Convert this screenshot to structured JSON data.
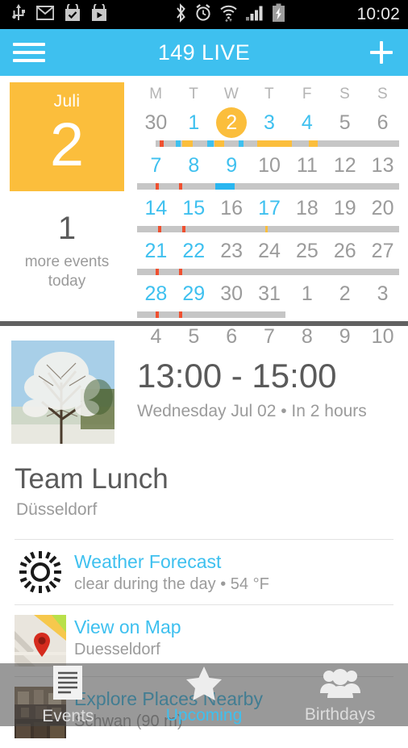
{
  "statusbar": {
    "time": "10:02",
    "left_icons": [
      "usb-icon",
      "gmail-icon",
      "checkmark-bag-icon",
      "play-store-icon"
    ],
    "right_icons": [
      "bluetooth-icon",
      "alarm-icon",
      "wifi-icon",
      "signal-icon",
      "battery-charging-icon"
    ]
  },
  "appbar": {
    "menu_icon": "hamburger-menu-icon",
    "title": "149 LIVE",
    "add_icon": "plus-icon",
    "background": "#3ec0ef"
  },
  "calendar": {
    "daycard": {
      "month": "Juli",
      "day": "2",
      "background": "#fbbe3c"
    },
    "more_count": "1",
    "more_label": "more events today",
    "weekday_headers": [
      "M",
      "T",
      "W",
      "T",
      "F",
      "S",
      "S"
    ],
    "accent_blue": "#3ec0ef",
    "accent_orange": "#fbbe3c",
    "weeks": [
      {
        "days": [
          {
            "n": "30",
            "state": "muted"
          },
          {
            "n": "1",
            "state": "active"
          },
          {
            "n": "2",
            "state": "today"
          },
          {
            "n": "3",
            "state": "active"
          },
          {
            "n": "4",
            "state": "active"
          },
          {
            "n": "5",
            "state": "muted"
          },
          {
            "n": "6",
            "state": "muted"
          }
        ],
        "bar": {
          "start_pct": 7,
          "end_pct": 99,
          "segments": [
            {
              "left_pct": 8.5,
              "width_pct": 1.6,
              "color": "#ef5030"
            },
            {
              "left_pct": 14.5,
              "width_pct": 2.0,
              "color": "#3ec0ef"
            },
            {
              "left_pct": 17.0,
              "width_pct": 4.0,
              "color": "#fbbe3c"
            },
            {
              "left_pct": 26.5,
              "width_pct": 2.4,
              "color": "#3ec0ef"
            },
            {
              "left_pct": 29.2,
              "width_pct": 3.6,
              "color": "#fbbe3c"
            },
            {
              "left_pct": 38.5,
              "width_pct": 1.8,
              "color": "#3ec0ef"
            },
            {
              "left_pct": 45.5,
              "width_pct": 13.0,
              "color": "#fbbe3c"
            },
            {
              "left_pct": 65.0,
              "width_pct": 3.2,
              "color": "#fbbe3c"
            }
          ]
        }
      },
      {
        "days": [
          {
            "n": "7",
            "state": "active"
          },
          {
            "n": "8",
            "state": "active"
          },
          {
            "n": "9",
            "state": "active"
          },
          {
            "n": "10",
            "state": "muted"
          },
          {
            "n": "11",
            "state": "muted"
          },
          {
            "n": "12",
            "state": "muted"
          },
          {
            "n": "13",
            "state": "muted"
          }
        ],
        "bar": {
          "start_pct": 0,
          "end_pct": 99,
          "segments": [
            {
              "left_pct": 7.0,
              "width_pct": 1.2,
              "color": "#ef5030"
            },
            {
              "left_pct": 16.0,
              "width_pct": 1.2,
              "color": "#ef5030"
            },
            {
              "left_pct": 29.5,
              "width_pct": 7.5,
              "color": "#29b6f0"
            }
          ]
        }
      },
      {
        "days": [
          {
            "n": "14",
            "state": "active"
          },
          {
            "n": "15",
            "state": "active"
          },
          {
            "n": "16",
            "state": "muted"
          },
          {
            "n": "17",
            "state": "active"
          },
          {
            "n": "18",
            "state": "muted"
          },
          {
            "n": "19",
            "state": "muted"
          },
          {
            "n": "20",
            "state": "muted"
          }
        ],
        "bar": {
          "start_pct": 0,
          "end_pct": 99,
          "segments": [
            {
              "left_pct": 8.0,
              "width_pct": 1.2,
              "color": "#ef5030"
            },
            {
              "left_pct": 17.0,
              "width_pct": 1.2,
              "color": "#ef5030"
            },
            {
              "left_pct": 48.5,
              "width_pct": 1.0,
              "color": "#fbbe3c"
            }
          ]
        }
      },
      {
        "days": [
          {
            "n": "21",
            "state": "active"
          },
          {
            "n": "22",
            "state": "active"
          },
          {
            "n": "23",
            "state": "muted"
          },
          {
            "n": "24",
            "state": "muted"
          },
          {
            "n": "25",
            "state": "muted"
          },
          {
            "n": "26",
            "state": "muted"
          },
          {
            "n": "27",
            "state": "muted"
          }
        ],
        "bar": {
          "start_pct": 0,
          "end_pct": 99,
          "segments": [
            {
              "left_pct": 7.0,
              "width_pct": 1.2,
              "color": "#ef5030"
            },
            {
              "left_pct": 16.0,
              "width_pct": 1.2,
              "color": "#ef5030"
            }
          ]
        }
      },
      {
        "days": [
          {
            "n": "28",
            "state": "active"
          },
          {
            "n": "29",
            "state": "active"
          },
          {
            "n": "30",
            "state": "muted"
          },
          {
            "n": "31",
            "state": "muted"
          },
          {
            "n": "1",
            "state": "muted"
          },
          {
            "n": "2",
            "state": "muted"
          },
          {
            "n": "3",
            "state": "muted"
          }
        ],
        "bar": {
          "start_pct": 0,
          "end_pct": 56,
          "segments": [
            {
              "left_pct": 7.0,
              "width_pct": 1.2,
              "color": "#ef5030"
            },
            {
              "left_pct": 16.0,
              "width_pct": 1.2,
              "color": "#ef5030"
            }
          ]
        }
      },
      {
        "days": [
          {
            "n": "4",
            "state": "muted"
          },
          {
            "n": "5",
            "state": "muted"
          },
          {
            "n": "6",
            "state": "muted"
          },
          {
            "n": "7",
            "state": "muted"
          },
          {
            "n": "8",
            "state": "muted"
          },
          {
            "n": "9",
            "state": "muted"
          },
          {
            "n": "10",
            "state": "muted"
          }
        ],
        "bar": null
      }
    ]
  },
  "event": {
    "thumbnail": "blossoming-tree-photo",
    "time_range": "13:00 - 15:00",
    "date_line": "Wednesday Jul 02 • In 2 hours",
    "title": "Team Lunch",
    "location": "Düsseldorf",
    "rows": [
      {
        "icon": "sun-icon",
        "title": "Weather Forecast",
        "sub": "clear during the day • 54 °F"
      },
      {
        "icon": "map-pin-icon",
        "title": "View on Map",
        "sub": "Duesseldorf"
      },
      {
        "icon": "place-photo-icon",
        "title": "Explore Places Nearby",
        "sub": "Schwan (90 m)"
      }
    ]
  },
  "bottomnav": {
    "items": [
      {
        "label": "Events",
        "icon": "document-icon",
        "active": false
      },
      {
        "label": "Upcoming",
        "icon": "star-icon",
        "active": true
      },
      {
        "label": "Birthdays",
        "icon": "people-icon",
        "active": false
      }
    ],
    "active_color": "#3ec0ef"
  }
}
